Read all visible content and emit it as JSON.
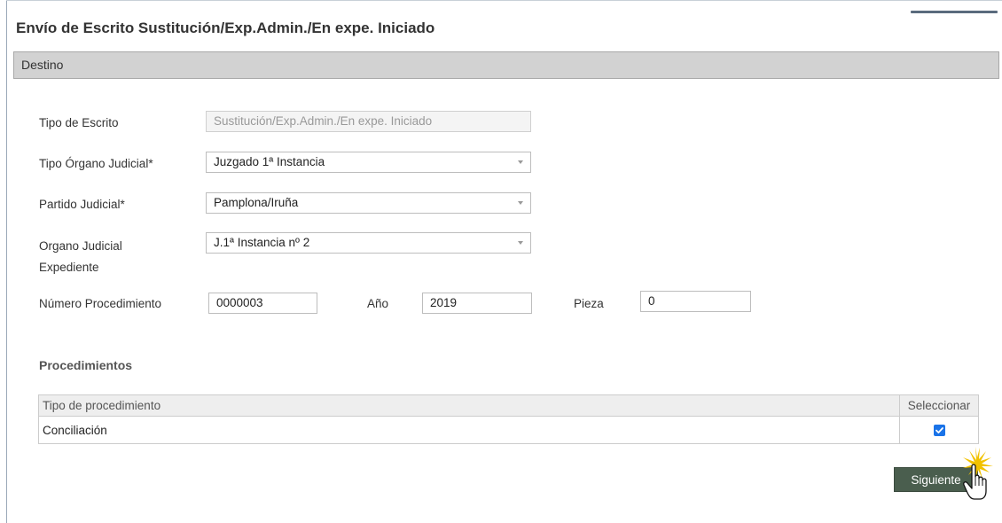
{
  "title": "Envío de Escrito Sustitución/Exp.Admin./En expe. Iniciado",
  "section": "Destino",
  "form": {
    "tipo_escrito": {
      "label": "Tipo de Escrito",
      "value": "Sustitución/Exp.Admin./En expe. Iniciado"
    },
    "tipo_organo": {
      "label": "Tipo Órgano Judicial*",
      "value": "Juzgado 1ª Instancia"
    },
    "partido": {
      "label": "Partido Judicial*",
      "value": "Pamplona/Iruña"
    },
    "organo": {
      "label": "Organo Judicial",
      "value": "J.1ª Instancia nº 2"
    },
    "expediente_label": "Expediente",
    "numero": {
      "label": "Número Procedimiento",
      "value": "0000003"
    },
    "anio": {
      "label": "Año",
      "value": "2019"
    },
    "pieza": {
      "label": "Pieza",
      "value": "0"
    }
  },
  "procedimientos": {
    "heading": "Procedimientos",
    "columns": [
      "Tipo de procedimiento",
      "Seleccionar"
    ],
    "rows": [
      {
        "tipo": "Conciliación",
        "selected": true
      }
    ]
  },
  "buttons": {
    "next": "Siguiente"
  },
  "colors": {
    "accent": "#1a73e8",
    "button_bg": "#4a5e4e",
    "section_bg": "#d2d2d2"
  },
  "icons": {
    "cursor": "hand-pointer-icon",
    "checkbox": "checkbox-checked-icon",
    "dropdown": "chevron-down-icon"
  }
}
